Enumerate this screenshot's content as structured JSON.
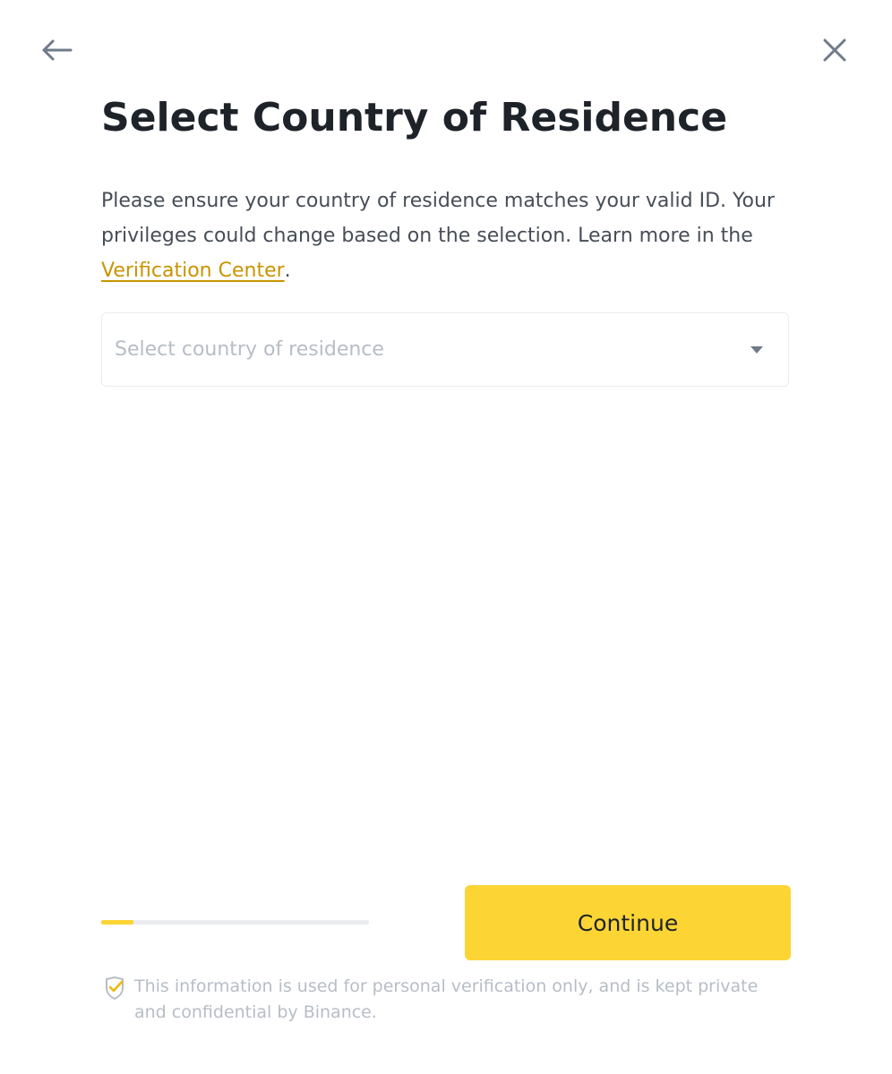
{
  "header": {
    "back_icon": "arrow-left-icon",
    "close_icon": "close-icon"
  },
  "title": "Select Country of Residence",
  "description": {
    "text": "Please ensure your country of residence matches your valid ID. Your privileges could change based on the selection. Learn more in the ",
    "link_label": "Verification Center",
    "suffix": "."
  },
  "country_select": {
    "placeholder": "Select country of residence",
    "value": "",
    "icon": "caret-down-icon"
  },
  "progress": {
    "fraction": 0.12
  },
  "continue_label": "Continue",
  "privacy": {
    "icon": "shield-check-icon",
    "text": "This information is used for personal verification only, and is kept private and confidential by Binance."
  },
  "colors": {
    "accent": "#fcd535",
    "link": "#c99400",
    "text_primary": "#1e2329",
    "text_secondary": "#474d57",
    "text_muted": "#b7bdc6",
    "border": "#eaecef"
  }
}
